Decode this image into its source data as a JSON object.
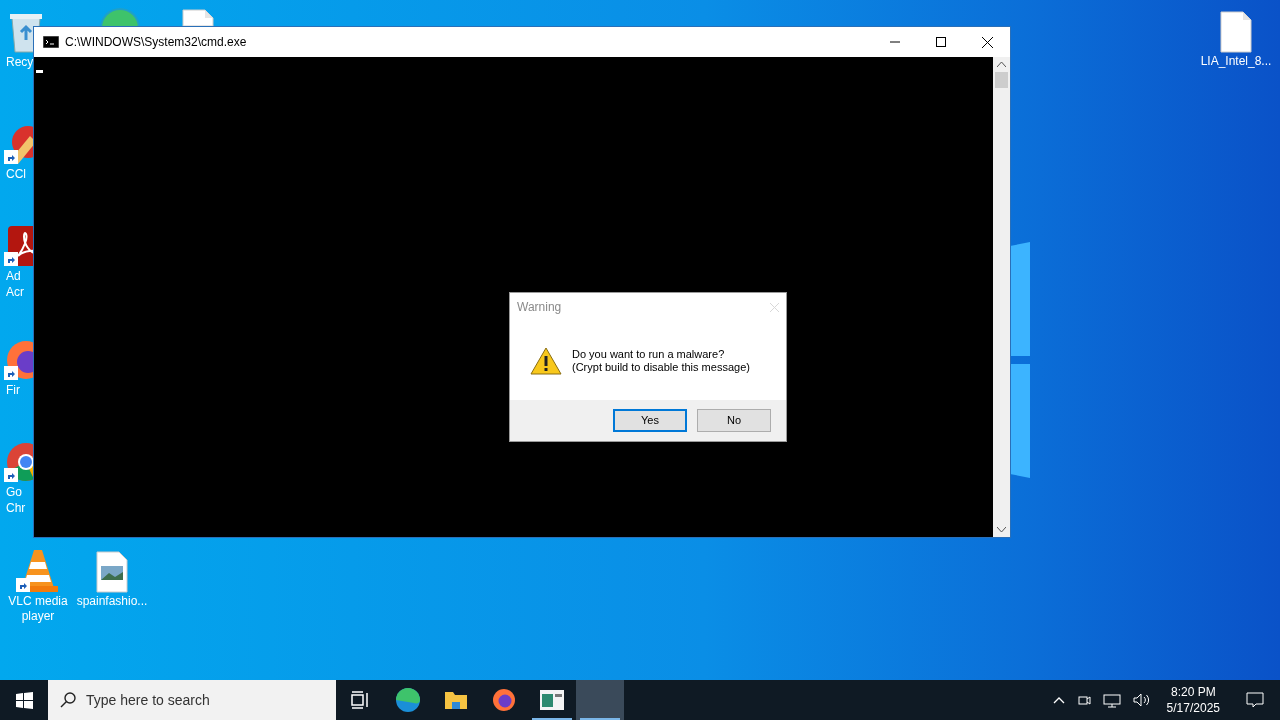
{
  "desktop_icons": [
    {
      "kind": "recycle",
      "label": "Recy",
      "shortcut": false
    },
    {
      "kind": "edge",
      "shortcut": false
    },
    {
      "kind": "document",
      "shortcut": false
    },
    {
      "kind": "ccleaner",
      "label": "CCl",
      "shortcut": true
    },
    {
      "kind": "acrobat",
      "label": "Ad Acr",
      "shortcut": true
    },
    {
      "kind": "firefox",
      "label": "Fir",
      "shortcut": true
    },
    {
      "kind": "chrome",
      "label": "Go Chr",
      "shortcut": true
    },
    {
      "kind": "vlc",
      "label": "VLC media player",
      "shortcut": true
    },
    {
      "kind": "image",
      "label": "spainfashio...",
      "shortcut": false
    },
    {
      "kind": "file",
      "label": "LIA_Intel_8...",
      "shortcut": false
    }
  ],
  "window": {
    "title": "C:\\WINDOWS\\System32\\cmd.exe",
    "cursor": true
  },
  "dialog": {
    "title": "Warning",
    "close_disabled": true,
    "message_lines": [
      "Do you want to run a malware?",
      "(Crypt build to disable this message)"
    ],
    "buttons": [
      {
        "label": "Yes",
        "default": true
      },
      {
        "label": "No",
        "default": false
      }
    ]
  },
  "taskbar": {
    "search": {
      "placeholder": "Type here to search"
    },
    "items": [
      {
        "kind": "taskview",
        "active": false,
        "focused": false
      },
      {
        "kind": "edge",
        "active": false,
        "focused": false
      },
      {
        "kind": "explorer",
        "active": false,
        "focused": false
      },
      {
        "kind": "firefox",
        "active": false,
        "focused": false
      },
      {
        "kind": "app",
        "active": true,
        "focused": false
      },
      {
        "kind": "blank",
        "active": true,
        "focused": true
      }
    ],
    "time": "8:20 PM",
    "date": "5/17/2025"
  }
}
